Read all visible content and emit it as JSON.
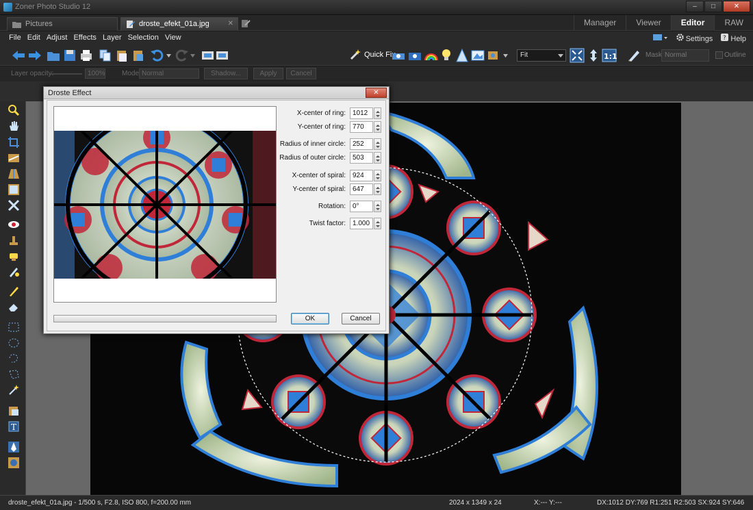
{
  "app": {
    "title": "Zoner Photo Studio 12"
  },
  "window_controls": {
    "minimize": "–",
    "maximize": "□",
    "close": "✕"
  },
  "tabs": [
    {
      "label": "Pictures",
      "close": ""
    },
    {
      "label": "droste_efekt_01a.jpg",
      "close": "✕"
    }
  ],
  "modes": [
    "Manager",
    "Viewer",
    "Editor",
    "RAW"
  ],
  "menu": [
    "File",
    "Edit",
    "Adjust",
    "Effects",
    "Layer",
    "Selection",
    "View"
  ],
  "menu_right": {
    "settings": "Settings",
    "help": "Help"
  },
  "toolbar": {
    "quick_fix": "Quick Fix",
    "zoom": "Fit",
    "mask_label": "Mask:",
    "mask_value": "Normal",
    "outline": "Outline"
  },
  "options": {
    "layer_opacity": "Layer opacity:",
    "opacity_value": "100%",
    "mode_label": "Mode:",
    "mode_value": "Normal",
    "shadow": "Shadow...",
    "apply": "Apply",
    "cancel": "Cancel"
  },
  "dialog": {
    "title": "Droste Effect",
    "close": "✕",
    "fields": [
      {
        "label": "X-center of ring:",
        "value": "1012"
      },
      {
        "label": "Y-center of ring:",
        "value": "770"
      },
      {
        "label": "Radius of inner circle:",
        "value": "252"
      },
      {
        "label": "Radius of outer circle:",
        "value": "503"
      },
      {
        "label": "X-center of spiral:",
        "value": "924"
      },
      {
        "label": "Y-center of spiral:",
        "value": "647"
      },
      {
        "label": "Rotation:",
        "value": "0°"
      },
      {
        "label": "Twist factor:",
        "value": "1.000"
      }
    ],
    "ok": "OK",
    "cancel": "Cancel"
  },
  "status": {
    "file_info": "droste_efekt_01a.jpg - 1/500 s, F2.8, ISO 800, f=200.00 mm",
    "dimensions": "2024 x 1349 x 24",
    "cursor": "X:---  Y:---",
    "selection": "DX:1012  DY:769  R1:251  R2:503  SX:924  SY:646"
  },
  "colors": {
    "glass_blue": "#2f7fd8",
    "glass_red": "#c0283a",
    "glass_light": "#e6ecd8",
    "selection": "#ffffff"
  }
}
